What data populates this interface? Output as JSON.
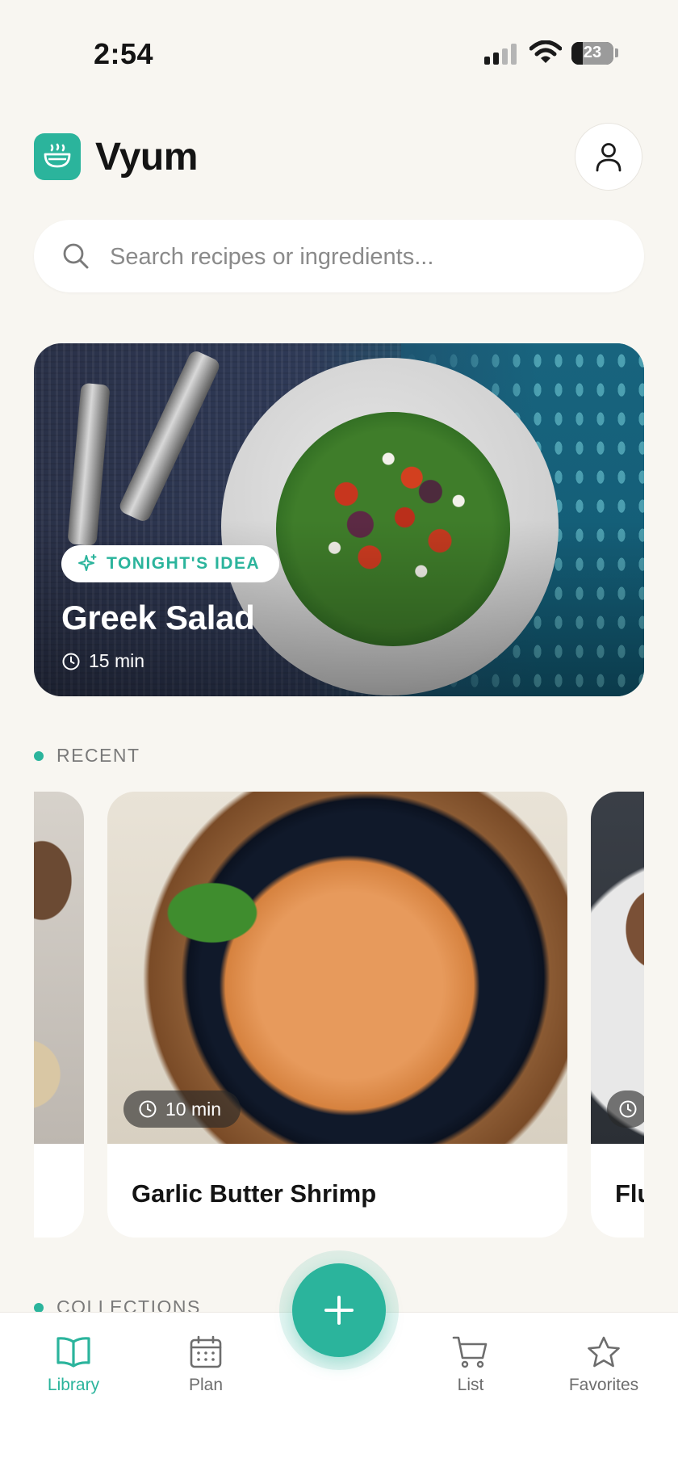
{
  "status_bar": {
    "time": "2:54",
    "battery_level": "23"
  },
  "header": {
    "app_name": "Vyum",
    "logo_icon": "bowl-steam-icon",
    "profile_icon": "user-icon"
  },
  "search": {
    "placeholder": "Search recipes or ingredients..."
  },
  "hero": {
    "badge": "TONIGHT'S IDEA",
    "title": "Greek Salad",
    "duration": "15 min"
  },
  "recent": {
    "label": "RECENT",
    "items": [
      {
        "title": "",
        "duration": ""
      },
      {
        "title": "Garlic Butter Shrimp",
        "duration": "10 min"
      },
      {
        "title": "Flu",
        "duration": ""
      }
    ]
  },
  "collections": {
    "label": "COLLECTIONS"
  },
  "nav": {
    "items": [
      {
        "label": "Library",
        "icon": "book-icon",
        "active": true
      },
      {
        "label": "Plan",
        "icon": "calendar-icon",
        "active": false
      },
      {
        "label": "List",
        "icon": "cart-icon",
        "active": false
      },
      {
        "label": "Favorites",
        "icon": "star-icon",
        "active": false
      }
    ],
    "add_icon": "plus-icon"
  },
  "colors": {
    "accent": "#2BB49C",
    "background": "#F8F6F1",
    "text": "#141414"
  }
}
